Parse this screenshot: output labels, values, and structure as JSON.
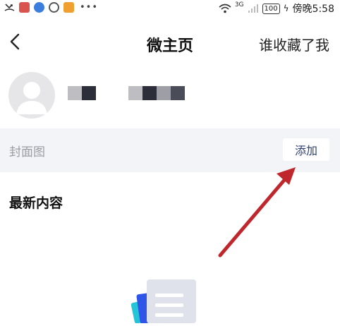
{
  "status_bar": {
    "time": "傍晚5:58",
    "battery": "100",
    "network": "3G",
    "more_dots": "•••",
    "colors": {
      "app1": "#d9534f",
      "app2": "#3b7ddd",
      "app3": "#555555",
      "app4": "#f0a030"
    }
  },
  "header": {
    "back_icon": "back-chevron-icon",
    "title": "微主页",
    "right_link": "谁收藏了我"
  },
  "cover": {
    "label": "封面图",
    "add_button": "添加"
  },
  "latest": {
    "title": "最新内容"
  },
  "accent_colors": {
    "add_text": "#2d3f73",
    "annotation_arrow": "#c0272d",
    "row_bg": "#f3f4f7"
  }
}
